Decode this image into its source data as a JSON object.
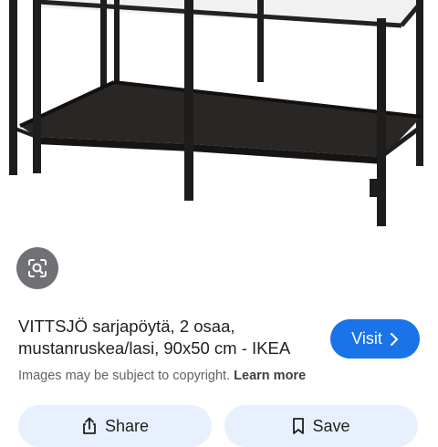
{
  "result": {
    "title_line1": "VITTSJÖ sarjapöytä, 2 osaa,",
    "title_line2": "mustanruskea/lasi, 90x50 cm - IKEA",
    "visit_label": "Visit",
    "copyright_text": "Images may be subject to copyright.",
    "learn_more_label": "Learn more"
  },
  "actions": {
    "share_label": "Share",
    "save_label": "Save"
  },
  "icons": {
    "lens": "lens-search-icon",
    "share": "share-icon",
    "save": "bookmark-icon",
    "visit": "chevron-right-icon"
  },
  "colors": {
    "accent": "#1a73e8",
    "action_bg": "#e8f0fe",
    "lens_bg": "#6f7175"
  }
}
